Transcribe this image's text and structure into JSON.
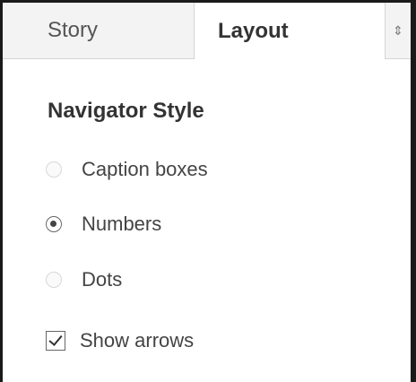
{
  "tabs": [
    {
      "label": "Story",
      "active": false
    },
    {
      "label": "Layout",
      "active": true
    }
  ],
  "more_tabs_icon": "updown-arrows-icon",
  "more_tabs_glyph": "⇕",
  "section": {
    "title": "Navigator Style",
    "options": [
      {
        "label": "Caption boxes",
        "type": "radio",
        "selected": false
      },
      {
        "label": "Numbers",
        "type": "radio",
        "selected": true
      },
      {
        "label": "Dots",
        "type": "radio",
        "selected": false
      }
    ],
    "show_arrows": {
      "label": "Show arrows",
      "checked": true
    }
  },
  "colors": {
    "active_tab_bg": "#ffffff",
    "inactive_tab_bg": "#f3f3f3",
    "text": "#444444"
  }
}
